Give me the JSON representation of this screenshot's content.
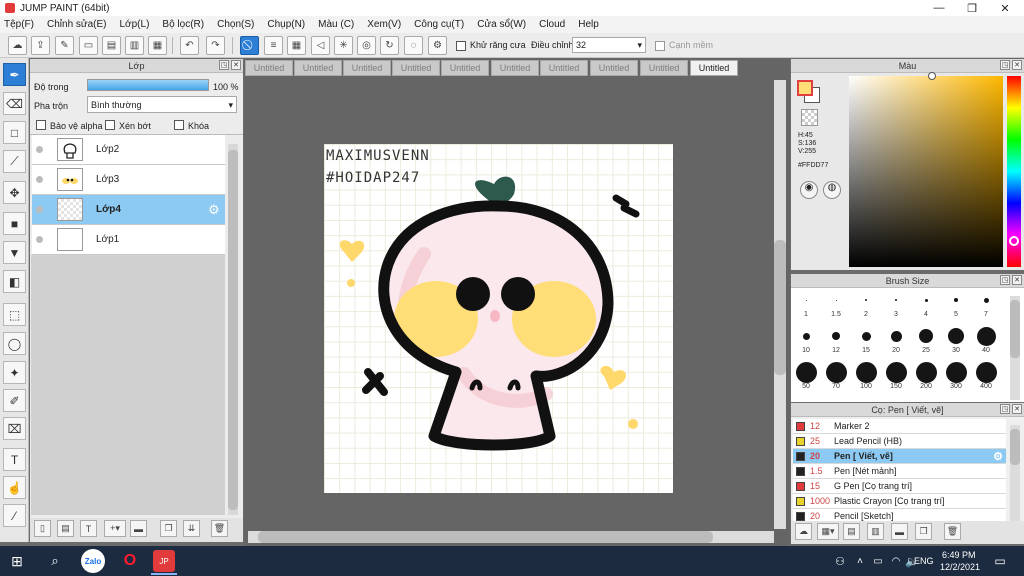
{
  "app": {
    "title": "JUMP PAINT (64bit)"
  },
  "menu": [
    "Tệp(F)",
    "Chỉnh sửa(E)",
    "Lớp(L)",
    "Bộ lọc(R)",
    "Chọn(S)",
    "Chụp(N)",
    "Màu (C)",
    "Xem(V)",
    "Công cụ(T)",
    "Cửa sổ(W)",
    "Cloud",
    "Help"
  ],
  "toolbar": {
    "antialias_label": "Khử răng cưa",
    "adjust_label": "Điều chỉnh",
    "adjust_value": "32",
    "correction_label": "Cạnh mềm"
  },
  "layers": {
    "title": "Lớp",
    "opacity_label": "Độ trong",
    "opacity_value": "100 %",
    "opacity_fraction": 1.0,
    "blend_label": "Pha trộn",
    "blend_value": "Bình thường",
    "protect_alpha": "Bảo vệ alpha",
    "clipping": "Xén bớt",
    "lock": "Khóa",
    "items": [
      {
        "name": "Lớp2"
      },
      {
        "name": "Lớp3"
      },
      {
        "name": "Lớp4",
        "selected": true
      },
      {
        "name": "Lớp1"
      }
    ]
  },
  "tabs": [
    "Untitled",
    "Untitled",
    "Untitled",
    "Untitled",
    "Untitled",
    "Untitled",
    "Untitled",
    "Untitled",
    "Untitled",
    "Untitled"
  ],
  "canvas": {
    "watermark_line1": "MAXIMUSVENN",
    "watermark_line2": "#HOIDAP247"
  },
  "color": {
    "title": "Màu",
    "h": "H:45",
    "s": "S:136",
    "v": "V:255",
    "hex": "#FFDD77",
    "main_color": "#ffdd77"
  },
  "brush": {
    "title": "Brush Size",
    "sizes": [
      "1",
      "1.5",
      "2",
      "3",
      "4",
      "5",
      "7",
      "10",
      "12",
      "15",
      "20",
      "25",
      "30",
      "40",
      "50",
      "70",
      "100",
      "150",
      "200",
      "300",
      "400"
    ]
  },
  "pens": {
    "title": "Cọ: Pen [ Viết, vẽ]",
    "items": [
      {
        "size": "12",
        "name": "Marker 2",
        "color": "#e03a3a"
      },
      {
        "size": "25",
        "name": "Lead Pencil (HB)",
        "color": "#e6d22a"
      },
      {
        "size": "20",
        "name": "Pen [ Viết, vẽ]",
        "color": "#222222",
        "selected": true
      },
      {
        "size": "1.5",
        "name": "Pen [Nét mảnh]",
        "color": "#222222"
      },
      {
        "size": "15",
        "name": "G Pen [Cọ trang trí]",
        "color": "#e03a3a"
      },
      {
        "size": "1000",
        "name": "Plastic Crayon [Cọ trang trí]",
        "color": "#e6d22a"
      },
      {
        "size": "20",
        "name": "Pencil [Sketch]",
        "color": "#222222"
      }
    ]
  },
  "taskbar": {
    "time": "6:49 PM",
    "date": "12/2/2021",
    "lang": "ENG"
  }
}
